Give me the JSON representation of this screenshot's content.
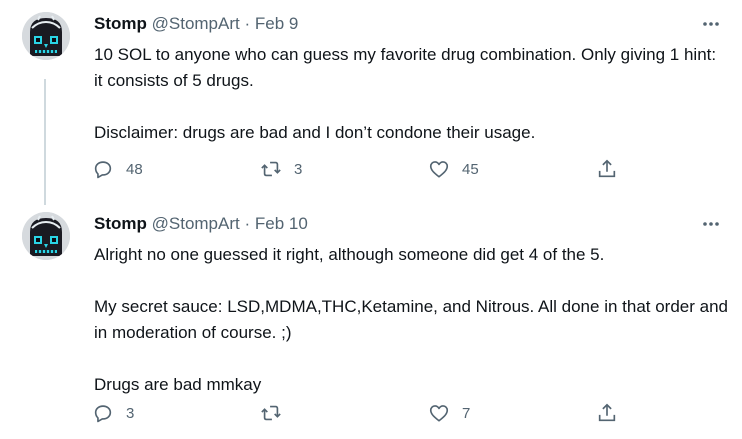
{
  "tweets": [
    {
      "name": "Stomp",
      "handle": "@StompArt",
      "dot": "·",
      "date": "Feb 9",
      "paragraphs": [
        "10 SOL to anyone who can guess my favorite drug combination. Only giving 1 hint: it consists of 5 drugs.",
        "Disclaimer: drugs are bad and I don’t condone their usage."
      ],
      "replies": "48",
      "retweets": "3",
      "likes": "45"
    },
    {
      "name": "Stomp",
      "handle": "@StompArt",
      "dot": "·",
      "date": "Feb 10",
      "paragraphs": [
        "Alright no one guessed it right, although someone did get 4 of the 5.",
        "My secret sauce: LSD,MDMA,THC,Ketamine, and Nitrous. All done in that order and in moderation of course. ;)",
        "Drugs are bad mmkay"
      ],
      "replies": "3",
      "retweets": "",
      "likes": "7"
    }
  ],
  "colors": {
    "text_primary": "#0f1419",
    "text_secondary": "#536471",
    "thread_line": "#cfd9de",
    "avatar_accent": "#2ad4e6"
  },
  "icons": {
    "reply": "reply-icon",
    "retweet": "retweet-icon",
    "like": "heart-icon",
    "share": "share-icon",
    "more": "more-icon"
  }
}
